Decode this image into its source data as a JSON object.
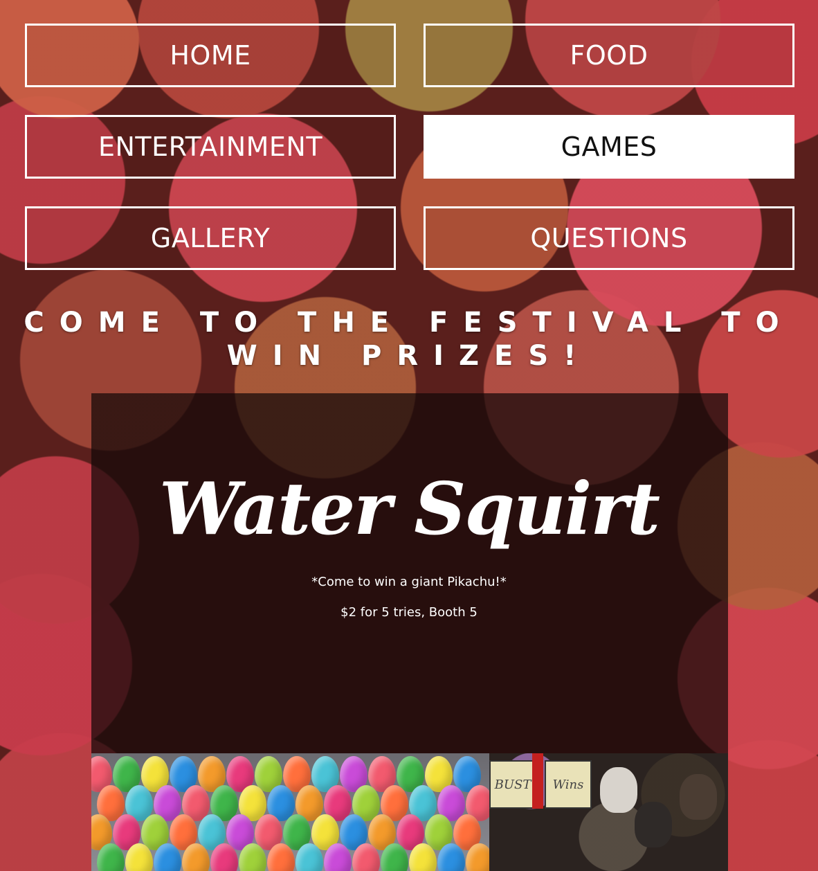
{
  "nav": {
    "items": [
      {
        "label": "HOME"
      },
      {
        "label": "FOOD"
      },
      {
        "label": "ENTERTAINMENT"
      },
      {
        "label": "GAMES"
      },
      {
        "label": "GALLERY"
      },
      {
        "label": "QUESTIONS"
      }
    ],
    "active": "GAMES"
  },
  "hero": {
    "title": "COME TO THE FESTIVAL TO WIN PRIZES!"
  },
  "game": {
    "name": "Water Squirt",
    "tagline": "*Come to win a giant Pikachu!*",
    "details": "$2 for 5 tries, Booth 5",
    "photo": {
      "sign_left": "BUST",
      "sign_right": "Wins"
    }
  },
  "colors": {
    "accent": "#ffffff",
    "overlay": "#140808"
  }
}
